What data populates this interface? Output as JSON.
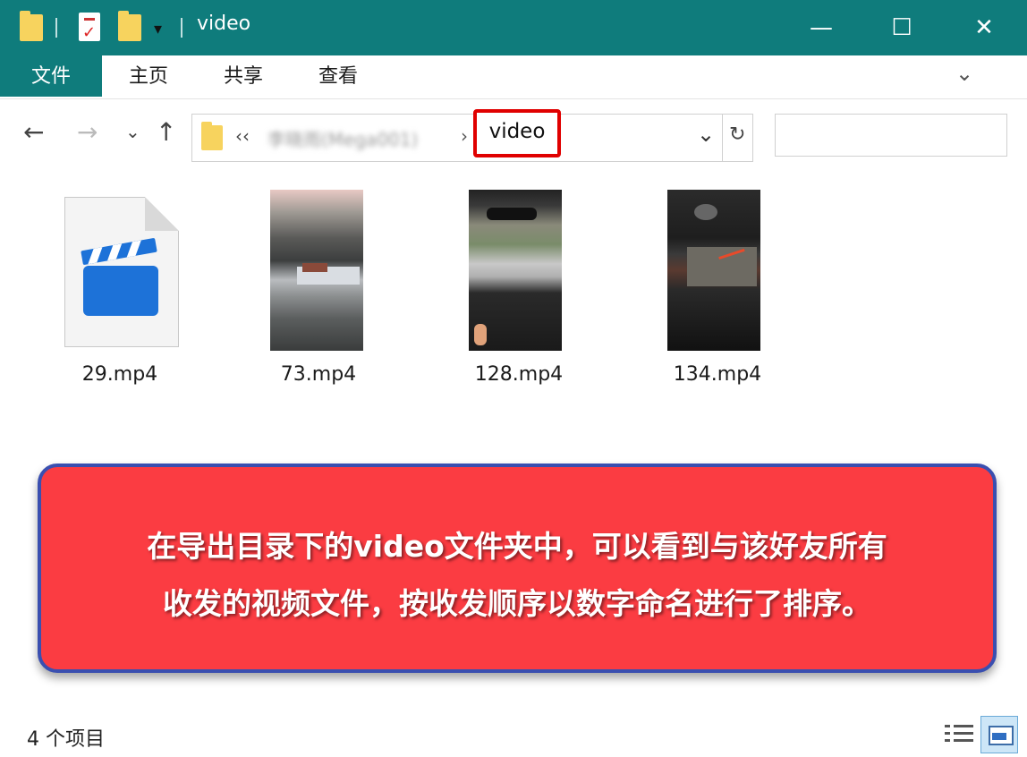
{
  "window": {
    "title": "video",
    "minimize_glyph": "—",
    "maximize_glyph": "☐",
    "close_glyph": "✕"
  },
  "ribbon": {
    "tabs": [
      {
        "label": "文件"
      },
      {
        "label": "主页"
      },
      {
        "label": "共享"
      },
      {
        "label": "查看"
      }
    ],
    "expand_glyph": "⌄"
  },
  "nav": {
    "back_glyph": "←",
    "forward_glyph": "→",
    "recent_glyph": "⌄",
    "up_glyph": "↑"
  },
  "address": {
    "prefix": "‹‹",
    "path_parent": "李晓雨(Mega001)",
    "path_sep": "›",
    "current": "video",
    "dropdown_glyph": "⌄",
    "refresh_glyph": "↻"
  },
  "search": {
    "placeholder": ""
  },
  "files": [
    {
      "name": "29.mp4",
      "kind": "generic-video"
    },
    {
      "name": "73.mp4",
      "kind": "thumbnail"
    },
    {
      "name": "128.mp4",
      "kind": "thumbnail"
    },
    {
      "name": "134.mp4",
      "kind": "thumbnail"
    }
  ],
  "callout": {
    "line1": "在导出目录下的video文件夹中，可以看到与该好友所有",
    "line2": "收发的视频文件，按收发顺序以数字命名进行了排序。"
  },
  "status": {
    "item_count": "4 个项目"
  },
  "colors": {
    "titlebar": "#0f7c7c",
    "callout_fill": "#fb3c42",
    "callout_border": "#3a4fb0",
    "highlight": "#e00000"
  }
}
